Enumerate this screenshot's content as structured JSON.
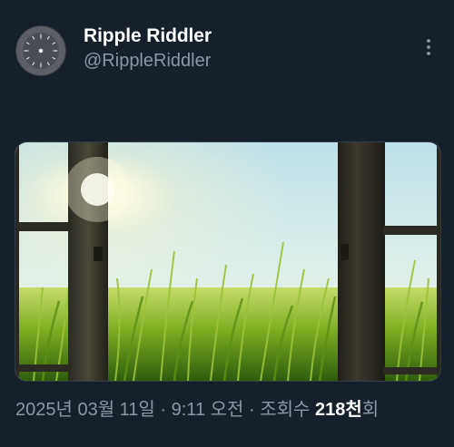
{
  "post": {
    "author": {
      "display_name": "Ripple Riddler",
      "handle": "@RippleRiddler",
      "avatar_icon": "clock-face-icon"
    },
    "more_icon": "more-vertical-icon",
    "media": {
      "type": "image"
    },
    "meta": {
      "date": "2025년 03월 11일",
      "separator": "·",
      "time": "9:11 오전",
      "views_label": "조회수",
      "views_count": "218천",
      "views_suffix": "회"
    }
  },
  "colors": {
    "background": "#15202b",
    "primary_text": "#ffffff",
    "secondary_text": "#8b98a5"
  }
}
